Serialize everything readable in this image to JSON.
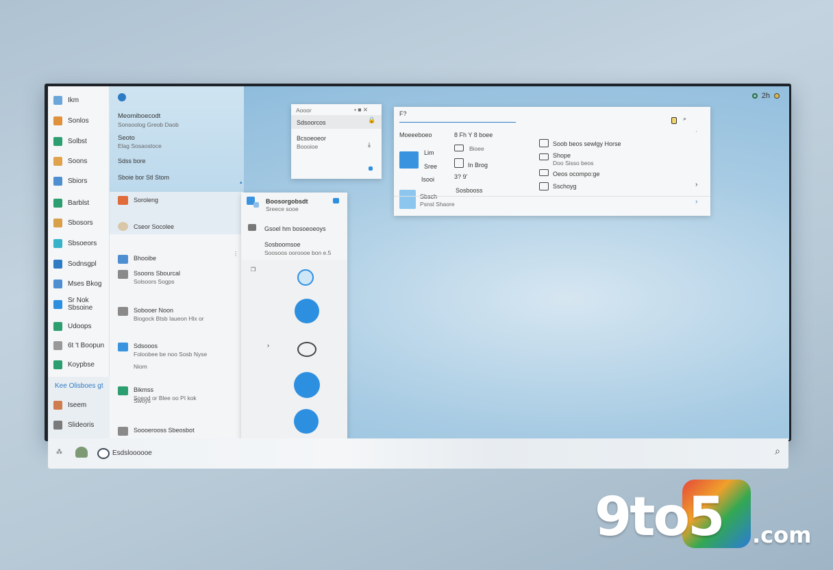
{
  "tray": {
    "text": "2h"
  },
  "rail": {
    "items": [
      {
        "label": "Ikm",
        "color": "#6aa6d9"
      },
      {
        "label": "Sonlos",
        "color": "#e0913b"
      },
      {
        "label": "Solbst",
        "color": "#2d9e6f"
      },
      {
        "label": "Soons",
        "color": "#e0a24b"
      },
      {
        "label": "Sbiors",
        "color": "#4e8fd1"
      },
      {
        "label": "Barblst",
        "color": "#2d9e6f"
      },
      {
        "label": "Sbosors",
        "color": "#d9a04a"
      },
      {
        "label": "Sbsoeors",
        "color": "#37b3c9"
      },
      {
        "label": "Sodnsgpl",
        "color": "#2f7bc4"
      },
      {
        "label": "Mses Bkog",
        "color": "#4e8fd1"
      },
      {
        "label": "Sr Nok Sbsoine",
        "color": "#2d8fe0"
      },
      {
        "label": "Udoops",
        "color": "#2d9e6f"
      },
      {
        "label": "6t 't Boopun",
        "color": "#999999"
      },
      {
        "label": "Koypbse",
        "color": "#2d9e6f"
      }
    ],
    "section_header": "Kee Olisboes gt",
    "bottom_items": [
      {
        "label": "Iseem",
        "color": "#d07d4e"
      },
      {
        "label": "Slideoris",
        "color": "#7a7a7a"
      }
    ]
  },
  "col2": {
    "top_item1_title": "Meomiboecodt",
    "top_item1_sub": "Sonsoolog Greob Daob",
    "top_item2_title": "Seoto",
    "top_item2_sub": "Elag Sosaostoce",
    "top_item3": "Sdss bore",
    "top_item4": "Sboie bor Stl Stom",
    "sel_item1": "Soroleng",
    "sel_item2": "Cseor Socolee",
    "list": [
      {
        "title": "Bhooibe",
        "sub": ""
      },
      {
        "title": "Ssoons Sbourcal",
        "sub": "Solsoors Sogps"
      },
      {
        "title": "Sobooer Noon",
        "sub": "Biogock Btsb Iaueon Hlx or"
      },
      {
        "title": "Sdsooos",
        "sub": "Foloobee be noo Sosb Nyse"
      },
      {
        "title": "",
        "sub": "Niom"
      },
      {
        "title": "Bikmss",
        "sub": "Soeod or Blee oo PI kok"
      },
      {
        "title": "",
        "sub": "Swoys"
      },
      {
        "title": "Soooerooss Sbeosbot",
        "sub": ""
      }
    ]
  },
  "popup_small": {
    "title": "Aooor",
    "item1": "Sdsoorcos",
    "item2": "Bcsoeoeor",
    "item3": "Boooioe"
  },
  "popup_list": {
    "title": "Boosorgobsdt",
    "sub": "Sreece sooe",
    "item1": "Gsoel hm bosoeoeoys",
    "item2": "Sosboomsoe",
    "item3": "Soosoos ooroooe bon e.5"
  },
  "popup_large": {
    "title": "F?",
    "col1_header": "Moeeeboeo",
    "col1_item1": "Lim",
    "col1_item2": "Sree",
    "col1_item3": "Isooi",
    "col1_bottom_title": "Sbsch",
    "col1_bottom_sub": "Psnsl Shaore",
    "col2_header": "8 Fh Y 8 boee",
    "col2_item1": "Bioee",
    "col2_item2": "In Brog",
    "col2_item3": "3? 9'",
    "col2_item4": "Sosbooss",
    "col3_item1": "Soob beos sewlgy Horse",
    "col3_item2_title": "Shope",
    "col3_item2_sub": "Doo Sisso beos",
    "col3_item3": "Oeos ocompo:ge",
    "col3_item4": "Sschoyg"
  },
  "taskbar": {
    "label": "Esdsloooooe"
  },
  "watermark": {
    "text1": "9to5",
    "text2": ".com"
  }
}
